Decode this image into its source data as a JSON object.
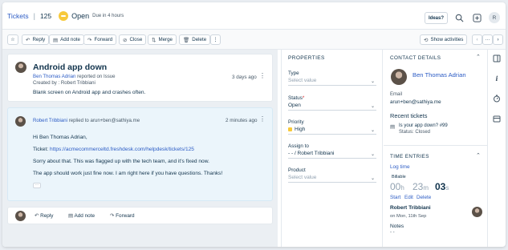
{
  "header": {
    "breadcrumb": "Tickets",
    "ticket_number": "125",
    "status": "Open",
    "due": "Due in 4 hours",
    "ideas_label": "Ideas?",
    "avatar_initial": "R"
  },
  "toolbar": {
    "reply": "Reply",
    "add_note": "Add note",
    "forward": "Forward",
    "close": "Close",
    "merge": "Merge",
    "delete": "Delete",
    "show_activities": "Show activities"
  },
  "ticket": {
    "subject": "Android app down",
    "requester": "Ben Thomas Adrian",
    "reported_text": "reported on Issue",
    "created_by": "Created by : Robert Tribbiani",
    "time": "3 days ago",
    "body": "Blank screen on Android app and crashes often."
  },
  "reply_msg": {
    "author": "Robert Tribbiani",
    "replied_to": "replied to",
    "to_email": "arun+ben@sathiya.me",
    "time": "2 minutes ago",
    "greeting": "Hi Ben Thomas Adrian,",
    "ticket_label": "Ticket:",
    "ticket_link": "https://acmecommerceltd.freshdesk.com/helpdesk/tickets/125",
    "line1": "Sorry about that. This was flagged up with the tech team, and it's fixed now.",
    "line2": "The app should work just fine now. I am right here if you have questions. Thanks!",
    "ellipsis": "···"
  },
  "bottom_bar": {
    "reply": "Reply",
    "add_note": "Add note",
    "forward": "Forward"
  },
  "properties": {
    "heading": "PROPERTIES",
    "type_label": "Type",
    "type_value": "Select value",
    "status_label": "Status",
    "status_value": "Open",
    "priority_label": "Priority",
    "priority_value": "High",
    "assign_label": "Assign to",
    "assign_value": "- - / Robert Tribbiani",
    "product_label": "Product",
    "product_value": "Select value",
    "required_mark": "*"
  },
  "contact": {
    "heading": "CONTACT DETAILS",
    "name": "Ben Thomas Adrian",
    "email_label": "Email",
    "email": "arun+ben@sathiya.me",
    "recent_heading": "Recent tickets",
    "recent_title": "Is your app down? #99",
    "recent_status": "Status: Closed"
  },
  "time_entries": {
    "heading": "TIME ENTRIES",
    "log_time": "Log time",
    "billable": "Billable",
    "hours": "00",
    "hours_unit": "h",
    "minutes": "23",
    "minutes_unit": "m",
    "seconds": "03",
    "seconds_unit": "s",
    "start": "Start",
    "edit": "Edit",
    "delete": "Delete",
    "agent": "Robert Tribbiani",
    "date": "on Mon, 11th Sep",
    "notes_label": "Notes",
    "notes_value": "- -"
  },
  "colors": {
    "link": "#2c5cc5",
    "status_yellow": "#f7c93b",
    "required_red": "#d72d30"
  }
}
